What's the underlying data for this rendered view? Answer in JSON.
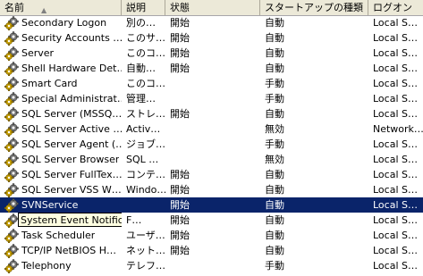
{
  "columns": {
    "name": "名前",
    "description": "説明",
    "status": "状態",
    "startup": "スタートアップの種類",
    "logon": "ログオン"
  },
  "services": [
    {
      "name": "Secondary Logon",
      "description": "別の…",
      "status": "開始",
      "startup": "自動",
      "logon": "Local S…"
    },
    {
      "name": "Security Accounts …",
      "description": "このサ…",
      "status": "開始",
      "startup": "自動",
      "logon": "Local S…"
    },
    {
      "name": "Server",
      "description": "このコ…",
      "status": "開始",
      "startup": "自動",
      "logon": "Local S…"
    },
    {
      "name": "Shell Hardware Det…",
      "description": "自動…",
      "status": "開始",
      "startup": "自動",
      "logon": "Local S…"
    },
    {
      "name": "Smart Card",
      "description": "このコ…",
      "status": "",
      "startup": "手動",
      "logon": "Local S…"
    },
    {
      "name": "Special Administrat…",
      "description": "管理…",
      "status": "",
      "startup": "手動",
      "logon": "Local S…"
    },
    {
      "name": "SQL Server (MSSQ…",
      "description": "ストレ…",
      "status": "開始",
      "startup": "自動",
      "logon": "Local S…"
    },
    {
      "name": "SQL Server Active …",
      "description": "Activ…",
      "status": "",
      "startup": "無効",
      "logon": "Network…"
    },
    {
      "name": "SQL Server Agent (…",
      "description": "ジョブ…",
      "status": "",
      "startup": "手動",
      "logon": "Local S…"
    },
    {
      "name": "SQL Server Browser",
      "description": "SQL …",
      "status": "",
      "startup": "無効",
      "logon": "Local S…"
    },
    {
      "name": "SQL Server FullTex…",
      "description": "コンテ…",
      "status": "開始",
      "startup": "自動",
      "logon": "Local S…"
    },
    {
      "name": "SQL Server VSS W…",
      "description": "Windo…",
      "status": "開始",
      "startup": "自動",
      "logon": "Local S…"
    },
    {
      "name": "SVNService",
      "description": "",
      "status": "開始",
      "startup": "自動",
      "logon": "Local S…",
      "selected": true
    },
    {
      "name": "System Event Notification",
      "description": "F…",
      "status": "開始",
      "startup": "自動",
      "logon": "Local S…",
      "tooltip": true
    },
    {
      "name": "Task Scheduler",
      "description": "ユーザ…",
      "status": "開始",
      "startup": "自動",
      "logon": "Local S…"
    },
    {
      "name": "TCP/IP NetBIOS H…",
      "description": "ネット…",
      "status": "開始",
      "startup": "自動",
      "logon": "Local S…"
    },
    {
      "name": "Telephony",
      "description": "テレフ…",
      "status": "",
      "startup": "手動",
      "logon": "Local S…"
    }
  ],
  "icons": {
    "service": "gear-service-icon",
    "sort": "sort-ascending-icon"
  },
  "colors": {
    "selection": "#0a246a",
    "tooltip_bg": "#ffffe1",
    "header_bg": "#ece9d8"
  }
}
